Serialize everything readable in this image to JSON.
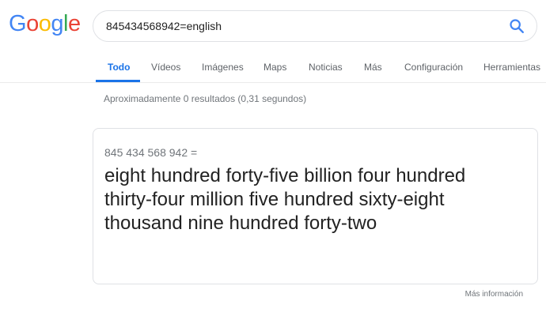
{
  "logo": {
    "letters": [
      "G",
      "o",
      "o",
      "g",
      "l",
      "e"
    ],
    "colors": [
      "#4285f4",
      "#ea4335",
      "#fbbc05",
      "#4285f4",
      "#34a853",
      "#ea4335"
    ]
  },
  "search": {
    "query": "845434568942=english",
    "icon": "search-icon",
    "icon_color": "#4285f4"
  },
  "tabs": [
    {
      "label": "Todo",
      "active": true
    },
    {
      "label": "Vídeos",
      "active": false
    },
    {
      "label": "Imágenes",
      "active": false
    },
    {
      "label": "Maps",
      "active": false
    },
    {
      "label": "Noticias",
      "active": false
    },
    {
      "label": "Más",
      "active": false
    },
    {
      "label": "Configuración",
      "active": false
    },
    {
      "label": "Herramientas",
      "active": false
    }
  ],
  "result_stats": "Aproximadamente 0 resultados (0,31 segundos)",
  "answer": {
    "input": "845 434 568 942 =",
    "output": "eight hundred forty-five billion four hundred thirty-four million five hundred sixty-eight thousand nine hundred forty-two"
  },
  "more_info": "Más información",
  "colors": {
    "accent": "#1a73e8",
    "muted_text": "#70757a",
    "border": "#dfe1e5"
  }
}
